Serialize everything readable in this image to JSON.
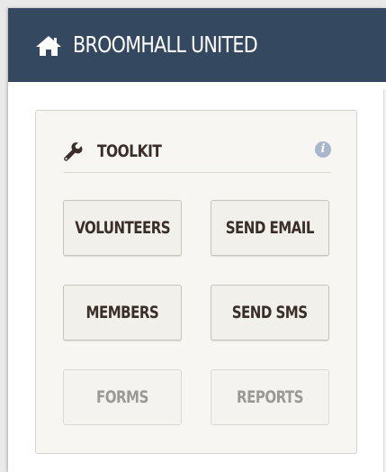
{
  "header": {
    "title": "BROOMHALL UNITED",
    "icon": "home-icon",
    "background": "#34485f"
  },
  "toolkit": {
    "title": "TOOLKIT",
    "icon": "wrench-icon",
    "info_icon": "info-icon",
    "info_glyph": "i",
    "buttons": [
      {
        "label": "VOLUNTEERS",
        "enabled": true
      },
      {
        "label": "SEND EMAIL",
        "enabled": true
      },
      {
        "label": "MEMBERS",
        "enabled": true
      },
      {
        "label": "SEND SMS",
        "enabled": true
      },
      {
        "label": "FORMS",
        "enabled": false
      },
      {
        "label": "REPORTS",
        "enabled": false
      }
    ]
  }
}
